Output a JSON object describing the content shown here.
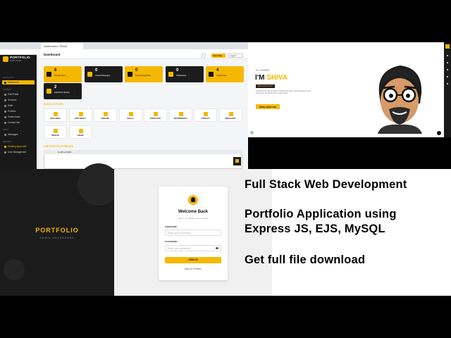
{
  "browser": {
    "tab_label": "Dashboard | Shiva",
    "url": "localhost:3000/admin/dashboard"
  },
  "admin": {
    "brand": "PORTFOLIO",
    "brand_sub": "ADMIN PANEL",
    "page_title": "Dashboard",
    "view_site": "View Site",
    "logout": "Logout",
    "sections": [
      "NAVIGATION",
      "CONTENT",
      "INBOX",
      "SECURITY"
    ],
    "menu": [
      {
        "label": "Dashboard",
        "state": "active"
      },
      {
        "label": "Edit Profile",
        "state": ""
      },
      {
        "label": "Services",
        "state": ""
      },
      {
        "label": "Skills",
        "state": ""
      },
      {
        "label": "Portfolio",
        "state": ""
      },
      {
        "label": "Testimonials",
        "state": ""
      },
      {
        "label": "Contact Info",
        "state": ""
      },
      {
        "label": "Messages",
        "state": ""
      },
      {
        "label": "Pending Approvals",
        "state": "hl"
      },
      {
        "label": "User Management",
        "state": ""
      }
    ],
    "stats": [
      {
        "num": "6",
        "label": "Portfolio Items",
        "style": "y"
      },
      {
        "num": "0",
        "label": "Unread Messages",
        "style": "d"
      },
      {
        "num": "0",
        "label": "Pending Approvals",
        "style": "y"
      },
      {
        "num": "0",
        "label": "Notifications",
        "style": "d"
      },
      {
        "num": "4",
        "label": "Testimonials",
        "style": "y"
      },
      {
        "num": "2",
        "label": "Experience Entries",
        "style": "d"
      }
    ],
    "quick_actions_title": "QUICK ACTIONS",
    "quick_actions": [
      "EDIT HERO",
      "EDIT ABOUT",
      "RESUME",
      "SKILLS",
      "PORTFOLIO",
      "TESTIMONIALS",
      "CONTACT",
      "MESSAGES",
      "PROFILE",
      "USERS"
    ],
    "preview_title": "LIVE PORTFOLIO PREVIEW",
    "preview_bar": "localhost:3000"
  },
  "hero": {
    "hi": "HI THERE!",
    "name_prefix": "I'M ",
    "name": "SHIVA",
    "badge": "WEB DEVELOPER",
    "para": "A passionate web developer building full-stack web applications and clean user interfaces with modern tools.",
    "button": "MORE ABOUT ME"
  },
  "login": {
    "brand": "PORTFOLIO",
    "brand_sub": "ADMIN DASHBOARD",
    "title": "Welcome Back",
    "subtitle": "Sign in to manage your portfolio",
    "username_label": "USERNAME",
    "username_placeholder": "Enter your username",
    "password_label": "PASSWORD",
    "password_placeholder": "Enter your password",
    "signin": "SIGN IN",
    "back": "Back to Portfolio"
  },
  "overlay": {
    "line1": "Full Stack Web Development",
    "line2": "Portfolio Application using",
    "line3": "Express JS, EJS, MySQL",
    "line4": "Get full file download"
  },
  "colors": {
    "accent": "#f5b800",
    "dark": "#1b1b1b"
  }
}
